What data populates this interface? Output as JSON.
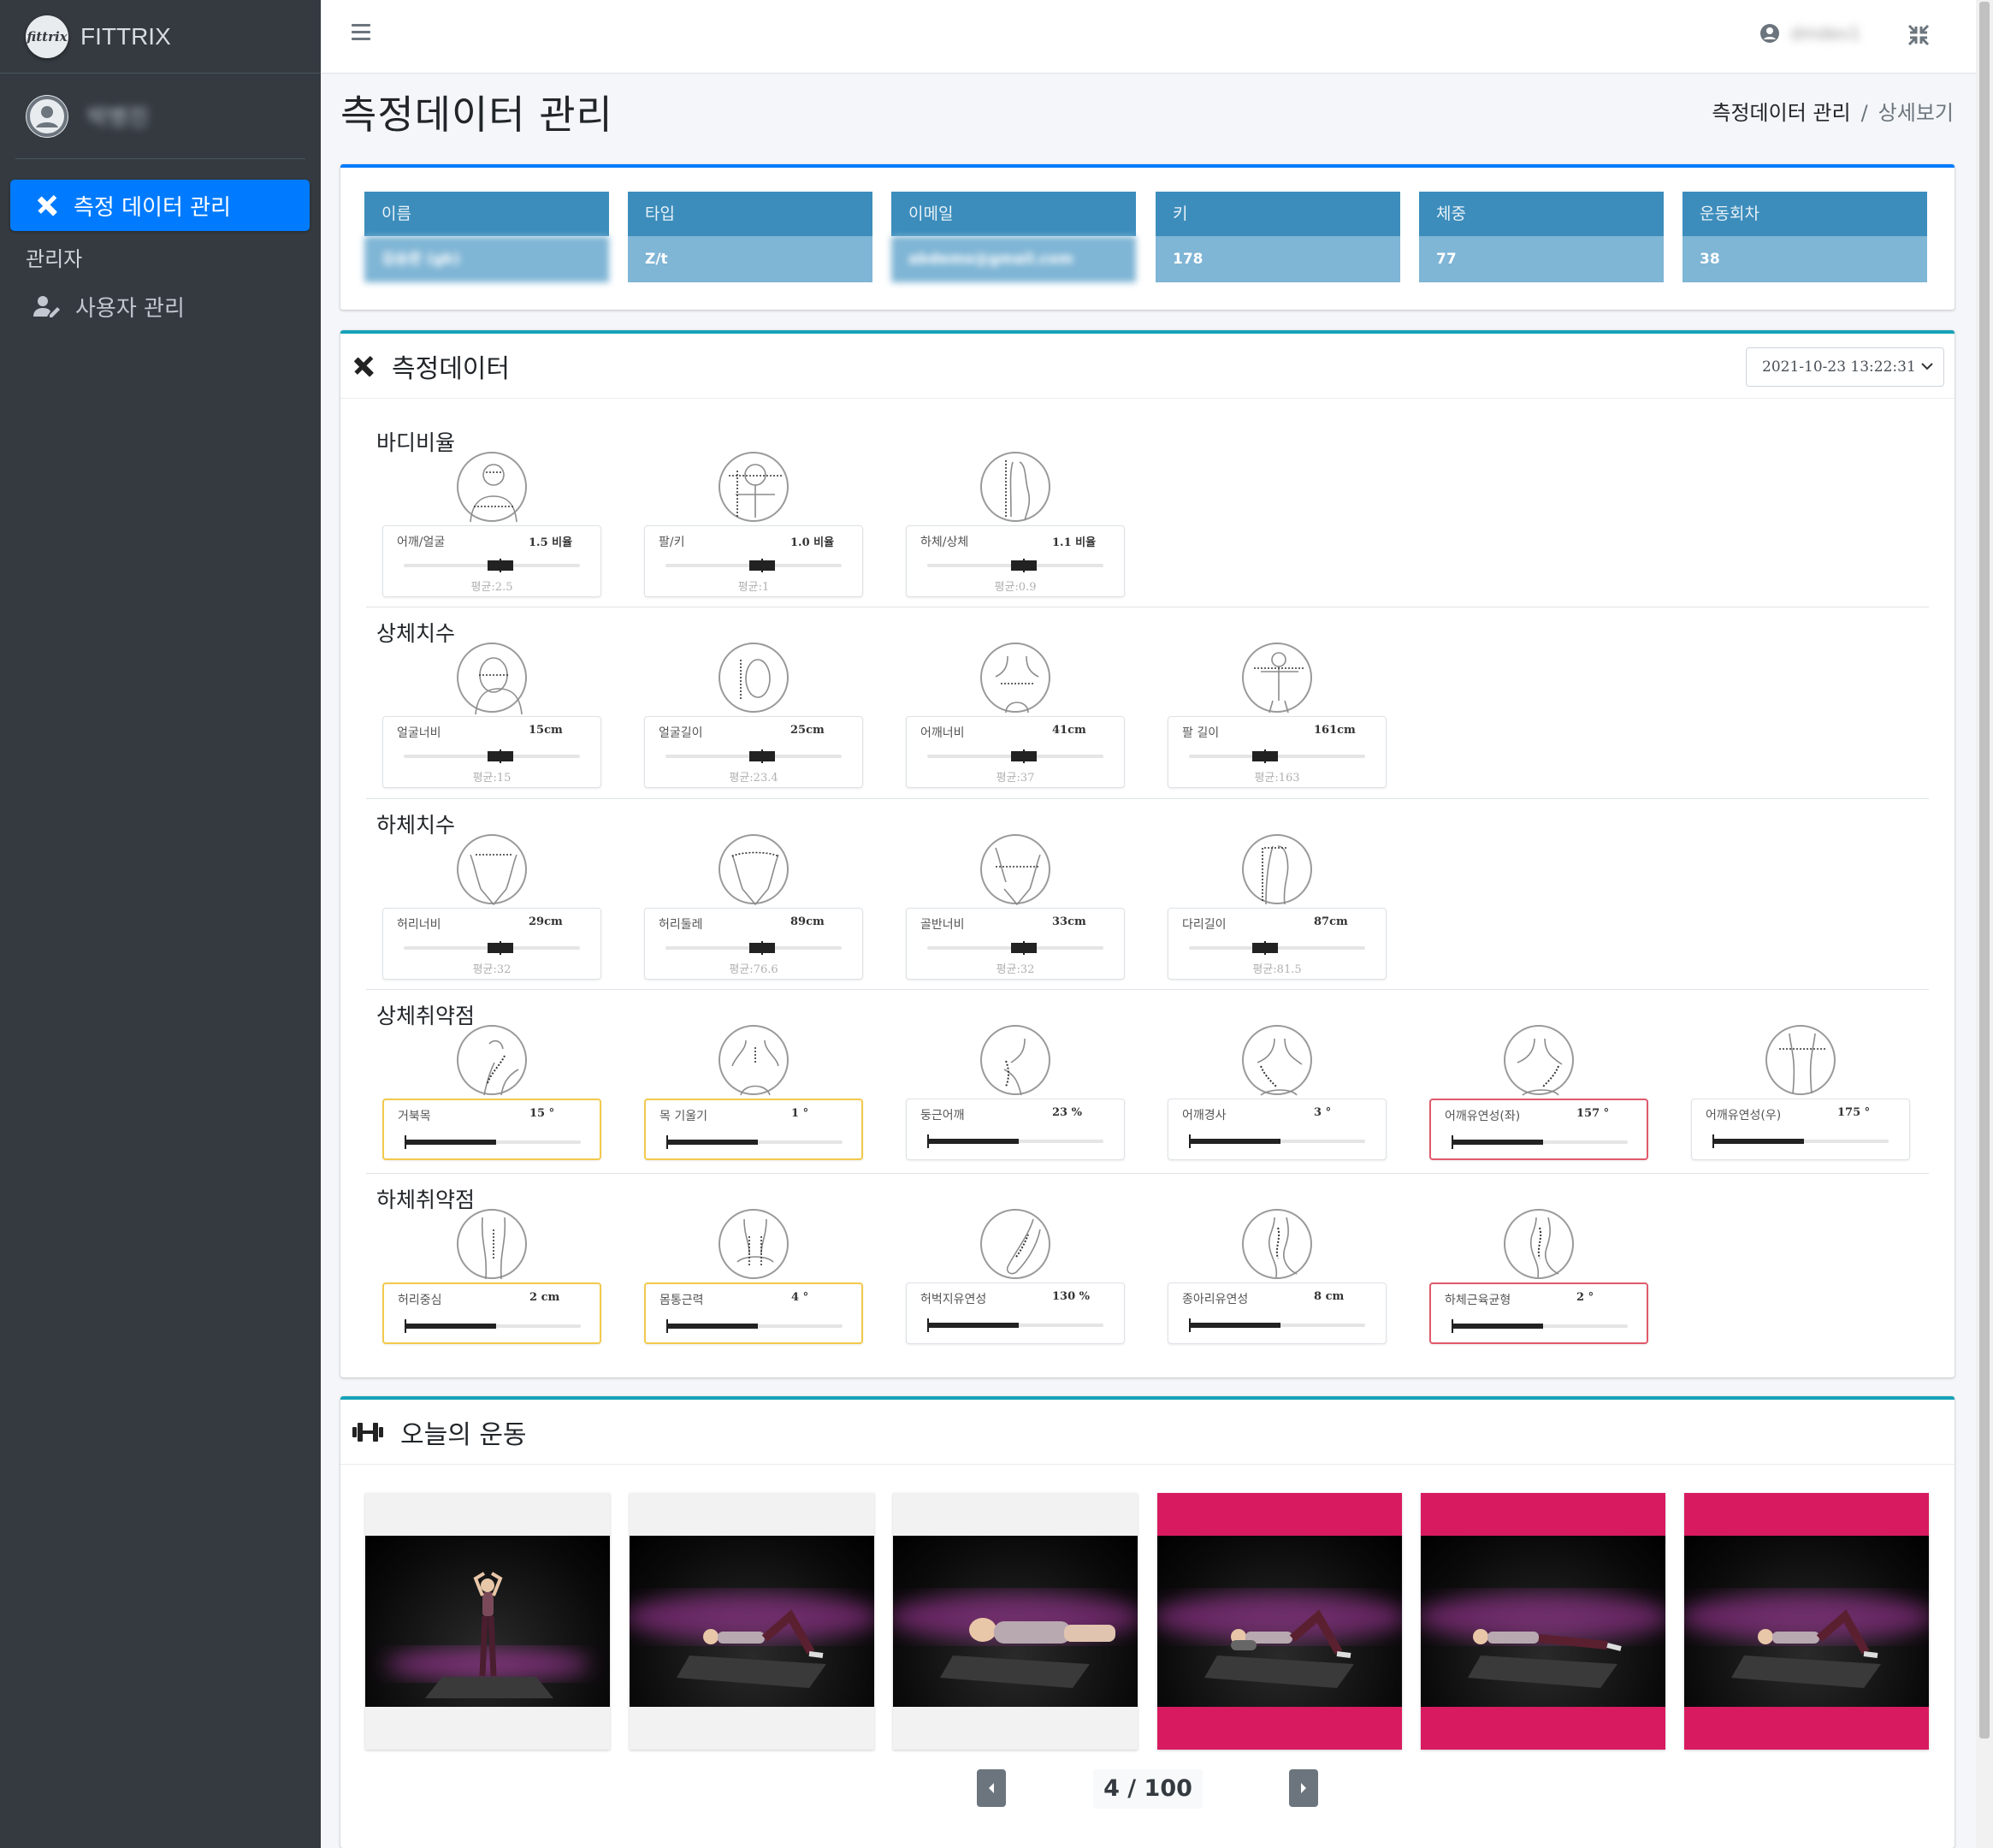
{
  "brand": {
    "logo_text": "fittrix",
    "name": "FITTRIX"
  },
  "sidebar": {
    "user_name": "박병진",
    "active_item": "측정 데이터 관리",
    "header": "관리자",
    "items": [
      {
        "label": "사용자 관리"
      }
    ]
  },
  "topbar": {
    "user_name": "dmdev1"
  },
  "page": {
    "title": "측정데이터 관리",
    "breadcrumb": [
      "측정데이터 관리",
      "/",
      "상세보기"
    ]
  },
  "info": [
    {
      "label": "이름",
      "value": "김승완 (gk)"
    },
    {
      "label": "타입",
      "value": "Z/t"
    },
    {
      "label": "이메일",
      "value": "abdemo@gmail.com"
    },
    {
      "label": "키",
      "value": "178"
    },
    {
      "label": "체중",
      "value": "77"
    },
    {
      "label": "운동회차",
      "value": "38"
    }
  ],
  "measure": {
    "title": "측정데이터",
    "date": "2021-10-23 13:22:31",
    "sections": [
      {
        "title": "바디비율",
        "items": [
          {
            "label": "어깨/얼굴",
            "value": "1.5 비율",
            "avg": "평균:2.5",
            "level": 0.55
          },
          {
            "label": "팔/키",
            "value": "1.0 비율",
            "avg": "평균:1",
            "level": 0.55
          },
          {
            "label": "하체/상체",
            "value": "1.1 비율",
            "avg": "평균:0.9",
            "level": 0.55
          }
        ]
      },
      {
        "title": "상체치수",
        "items": [
          {
            "label": "얼굴너비",
            "value": "15cm",
            "avg": "평균:15",
            "level": 0.55
          },
          {
            "label": "얼굴길이",
            "value": "25cm",
            "avg": "평균:23.4",
            "level": 0.55
          },
          {
            "label": "어깨너비",
            "value": "41cm",
            "avg": "평균:37",
            "level": 0.55
          },
          {
            "label": "팔 길이",
            "value": "161cm",
            "avg": "평균:163",
            "level": 0.43
          }
        ]
      },
      {
        "title": "하체치수",
        "items": [
          {
            "label": "허리너비",
            "value": "29cm",
            "avg": "평균:32",
            "level": 0.55
          },
          {
            "label": "허리둘레",
            "value": "89cm",
            "avg": "평균:76.6",
            "level": 0.55
          },
          {
            "label": "골반너비",
            "value": "33cm",
            "avg": "평균:32",
            "level": 0.55
          },
          {
            "label": "다리길이",
            "value": "87cm",
            "avg": "평균:81.5",
            "level": 0.43
          }
        ]
      },
      {
        "title": "상체취약점",
        "items": [
          {
            "label": "거북목",
            "value": "15 °",
            "level": 0.52,
            "status": "warn"
          },
          {
            "label": "목 기울기",
            "value": "1 °",
            "level": 0.52,
            "status": "warn"
          },
          {
            "label": "둥근어깨",
            "value": "23 %",
            "level": 0.52,
            "status": "normal"
          },
          {
            "label": "어깨경사",
            "value": "3 °",
            "level": 0.52,
            "status": "normal"
          },
          {
            "label": "어깨유연성(좌)",
            "value": "157 °",
            "level": 0.52,
            "status": "danger"
          },
          {
            "label": "어깨유연성(우)",
            "value": "175 °",
            "level": 0.52,
            "status": "normal"
          }
        ]
      },
      {
        "title": "하체취약점",
        "items": [
          {
            "label": "허리중심",
            "value": "2 cm",
            "level": 0.52,
            "status": "warn"
          },
          {
            "label": "몸통근력",
            "value": "4 °",
            "level": 0.52,
            "status": "warn"
          },
          {
            "label": "허벅지유연성",
            "value": "130 %",
            "level": 0.52,
            "status": "normal"
          },
          {
            "label": "종아리유연성",
            "value": "8 cm",
            "level": 0.52,
            "status": "normal"
          },
          {
            "label": "하체근육균형",
            "value": "2 °",
            "level": 0.52,
            "status": "danger"
          }
        ]
      }
    ]
  },
  "exercise": {
    "title": "오늘의 운동",
    "cards": [
      {
        "selected": false,
        "pose": "standing"
      },
      {
        "selected": false,
        "pose": "lying-knees"
      },
      {
        "selected": false,
        "pose": "lying-close"
      },
      {
        "selected": true,
        "pose": "lying-roller"
      },
      {
        "selected": true,
        "pose": "lying-flat"
      },
      {
        "selected": true,
        "pose": "lying-knees"
      }
    ],
    "pager": "4 / 100"
  },
  "colors": {
    "sidebar_bg": "#343a40",
    "primary": "#007bff",
    "info": "#17a2b8",
    "info_label_bg": "#3c8dbc",
    "info_value_bg": "#7fb5d5",
    "warn_border": "#f2c94c",
    "danger_border": "#e05a6b",
    "selected_card": "#d81b60"
  },
  "icons": {
    "menu": "hamburger-icon",
    "user": "user-circle-icon",
    "compress": "compress-icon",
    "measure": "ruler-pencil-icon",
    "user_edit": "user-edit-icon",
    "exercise": "dumbbell-icon",
    "prev": "caret-left-icon",
    "next": "caret-right-icon"
  }
}
